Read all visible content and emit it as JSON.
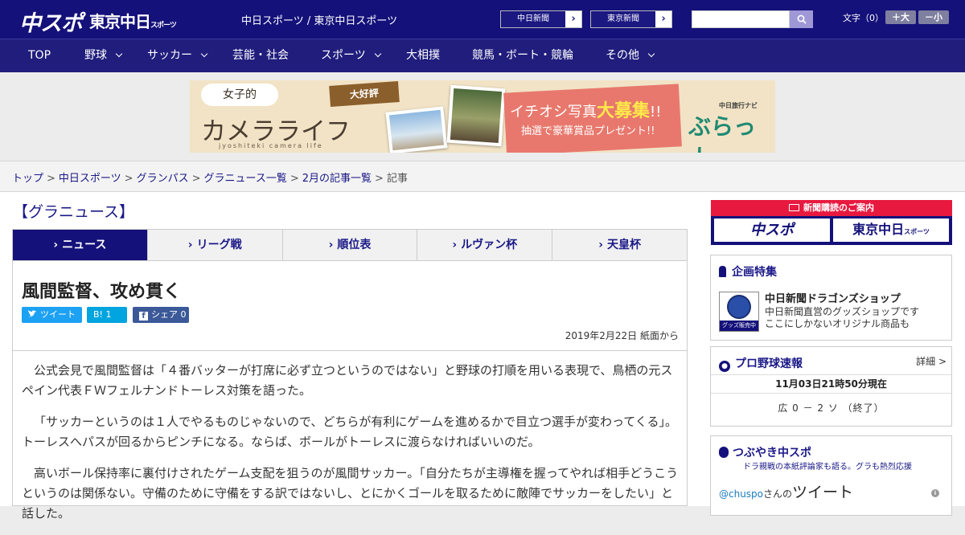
{
  "header": {
    "logo_chuspo": "中スポ",
    "logo_tokyo": "東京中日",
    "logo_tokyo_suffix": "スポーツ",
    "site_names": "中日スポーツ / 東京中日スポーツ",
    "site_buttons": [
      {
        "label": "中日新聞",
        "arrow": "›"
      },
      {
        "label": "東京新聞",
        "arrow": "›"
      }
    ],
    "search_placeholder": "",
    "font_size_label": "文字（0）",
    "font_bigger": "＋大",
    "font_smaller": "－小"
  },
  "nav": {
    "items": [
      {
        "label": "TOP"
      },
      {
        "label": "野球"
      },
      {
        "label": "サッカー"
      },
      {
        "label": "芸能・社会"
      },
      {
        "label": "スポーツ"
      },
      {
        "label": "大相撲"
      },
      {
        "label": "競馬・ボート・競輪"
      },
      {
        "label": "その他"
      }
    ]
  },
  "banner": {
    "bubble": "女子的",
    "title": "カメラライフ",
    "roman": "jyoshiteki camera life",
    "ribbon": "大好評",
    "headline_pre": "イチオシ写真",
    "headline_em": "大募集",
    "headline_post": "!!",
    "subline": "抽選で豪華賞品プレゼント!!",
    "navi_small": "中日旅行ナビ",
    "navi": "ぶらっ人"
  },
  "breadcrumb": {
    "items": [
      "トップ",
      "中日スポーツ",
      "グランパス",
      "グラニュース一覧",
      "2月の記事一覧"
    ],
    "current": "記事",
    "separator": ">"
  },
  "section": {
    "title": "【グラニュース】"
  },
  "tabs": {
    "caret": "›",
    "items": [
      {
        "label": "ニュース",
        "active": true
      },
      {
        "label": "リーグ戦",
        "active": false
      },
      {
        "label": "順位表",
        "active": false
      },
      {
        "label": "ルヴァン杯",
        "active": false
      },
      {
        "label": "天皇杯",
        "active": false
      }
    ]
  },
  "article": {
    "title": "風間監督、攻め貫く",
    "share_tweet": "ツイート",
    "share_hatena": "B! 1",
    "share_facebook": "シェア 0",
    "date": "2019年2月22日 紙面から",
    "paragraphs": [
      "公式会見で風間監督は「４番バッターが打席に必ず立つというのではない」と野球の打順を用いる表現で、鳥栖の元スペイン代表ＦＷフェルナンドトーレス対策を語った。",
      "「サッカーというのは１人でやるものじゃないので、どちらが有利にゲームを進めるかで目立つ選手が変わってくる」。トーレスへパスが回るからピンチになる。ならば、ボールがトーレスに渡らなければいいのだ。",
      "高いボール保持率に裏付けされたゲーム支配を狙うのが風間サッカー。「自分たちが主導権を握ってやれば相手どうこうというのは関係ない。守備のために守備をする訳ではないし、とにかくゴールを取るために敵陣でサッカーをしたい」と話した。"
    ]
  },
  "sidebar": {
    "subscribe": {
      "title": "新聞購読のご案内",
      "logo1": "中スポ",
      "logo2": "東京中日",
      "logo2_suffix": "スポーツ"
    },
    "kikaku": {
      "title": "企画特集",
      "shop_name": "中日新聞ドラゴンズショップ",
      "shop_desc1": "中日新聞直営のグッズショップです",
      "shop_desc2": "ここにしかないオリジナル商品も",
      "thumb_text": "グッズ販売中"
    },
    "baseball": {
      "title": "プロ野球速報",
      "detail": "詳細 >",
      "time": "11月03日21時50分現在",
      "score": "広 0 － 2 ソ （終了）"
    },
    "tweets": {
      "title": "つぶやき中スポ",
      "subtitle": "ドラ親戦の本紙評論家も語る。グラも熱烈応援",
      "handle": "@chuspo",
      "handle_suffix": "さんの",
      "big": "ツイート"
    }
  },
  "colors": {
    "header_bg": "#14117a",
    "nav_bg": "#201d7d",
    "accent_red": "#e8193f",
    "link": "#1a1887"
  }
}
